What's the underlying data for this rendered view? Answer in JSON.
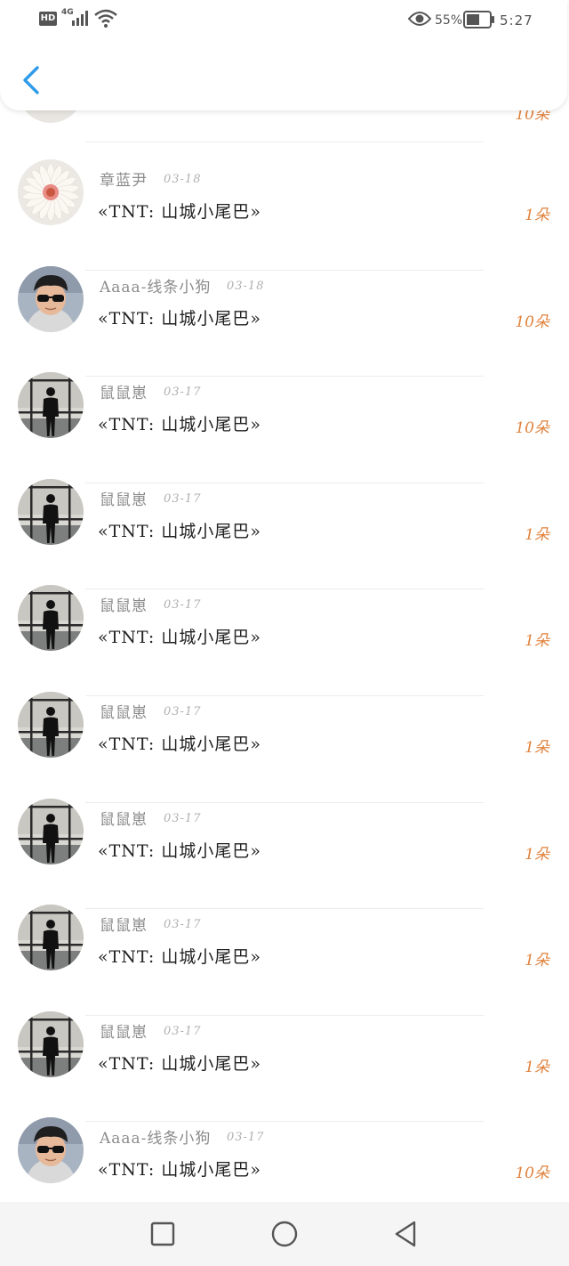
{
  "status_bar": {
    "hd": "HD",
    "network": "4G",
    "battery_percent": "55%",
    "time": "5:27",
    "icons": [
      "signal-icon",
      "wifi-icon",
      "eye-icon",
      "battery-icon"
    ]
  },
  "header": {
    "back_icon": "chevron-left-icon",
    "accent_color": "#2e9be8"
  },
  "partial_top_row": {
    "amount": "10朵"
  },
  "rows": [
    {
      "name": "章蓝尹",
      "date": "03-18",
      "title": "«TNT: 山城小尾巴»",
      "amount": "1朵",
      "avatar": "flower"
    },
    {
      "name": "Aaaa-线条小狗",
      "date": "03-18",
      "title": "«TNT: 山城小尾巴»",
      "amount": "10朵",
      "avatar": "boy"
    },
    {
      "name": "鼠鼠崽",
      "date": "03-17",
      "title": "«TNT: 山城小尾巴»",
      "amount": "10朵",
      "avatar": "silhouette"
    },
    {
      "name": "鼠鼠崽",
      "date": "03-17",
      "title": "«TNT: 山城小尾巴»",
      "amount": "1朵",
      "avatar": "silhouette"
    },
    {
      "name": "鼠鼠崽",
      "date": "03-17",
      "title": "«TNT: 山城小尾巴»",
      "amount": "1朵",
      "avatar": "silhouette"
    },
    {
      "name": "鼠鼠崽",
      "date": "03-17",
      "title": "«TNT: 山城小尾巴»",
      "amount": "1朵",
      "avatar": "silhouette"
    },
    {
      "name": "鼠鼠崽",
      "date": "03-17",
      "title": "«TNT: 山城小尾巴»",
      "amount": "1朵",
      "avatar": "silhouette"
    },
    {
      "name": "鼠鼠崽",
      "date": "03-17",
      "title": "«TNT: 山城小尾巴»",
      "amount": "1朵",
      "avatar": "silhouette"
    },
    {
      "name": "鼠鼠崽",
      "date": "03-17",
      "title": "«TNT: 山城小尾巴»",
      "amount": "1朵",
      "avatar": "silhouette"
    },
    {
      "name": "Aaaa-线条小狗",
      "date": "03-17",
      "title": "«TNT: 山城小尾巴»",
      "amount": "10朵",
      "avatar": "boy"
    }
  ],
  "colors": {
    "amount": "#e0823d",
    "name": "#8b8b8b",
    "date": "#b0b0b0",
    "title": "#222222"
  },
  "navbar": {
    "buttons": [
      "recent-apps-icon",
      "home-icon",
      "back-triangle-icon"
    ]
  }
}
